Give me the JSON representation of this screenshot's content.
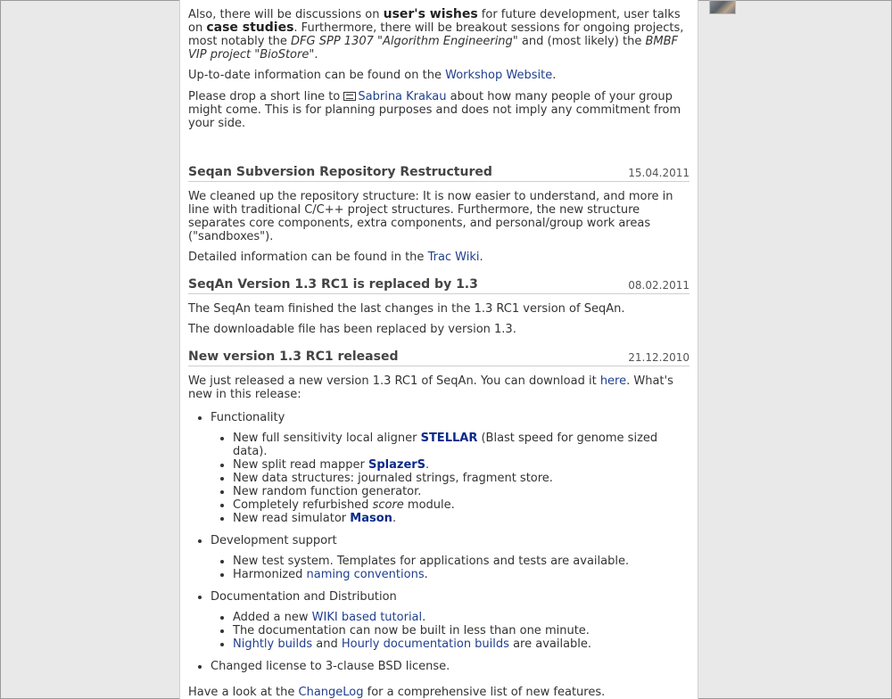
{
  "intro": {
    "p1": {
      "a": "Also, there will be discussions on ",
      "b": "user's wishes",
      "c": " for future development, user talks on ",
      "d": "case studies",
      "e": ". Furthermore, there will be breakout sessions for ongoing projects, most notably the ",
      "f": "DFG SPP 1307 \"Algorithm Engineering\"",
      "g": " and (most likely) the ",
      "h": "BMBF VIP project \"BioStore\"",
      "i": "."
    },
    "p2": {
      "a": "Up-to-date information can be found on the ",
      "link": "Workshop Website",
      "b": "."
    },
    "p3": {
      "a": "Please drop a short line to ",
      "link": "Sabrina Krakau",
      "b": " about how many people of your group might come. This is for planning purposes and does not imply any commitment from your side."
    }
  },
  "news": [
    {
      "title": "Seqan Subversion Repository Restructured",
      "date": "15.04.2011",
      "p1": "We cleaned up the repository structure: It is now easier to understand, and more in line with traditional C/C++ project structures. Furthermore, the new structure separates core components, extra components, and personal/group work areas (\"sandboxes\").",
      "p2a": "Detailed information can be found in the ",
      "p2link": "Trac Wiki",
      "p2b": "."
    },
    {
      "title": "SeqAn Version 1.3 RC1 is replaced by 1.3",
      "date": "08.02.2011",
      "p1": "The SeqAn team finished the last changes in the 1.3 RC1 version of SeqAn.",
      "p2": "The downloadable file has been replaced by version 1.3."
    },
    {
      "title": "New version 1.3 RC1 released",
      "date": "21.12.2010",
      "p1a": "We just released a new version 1.3 RC1 of SeqAn. You can download it ",
      "p1link": "here",
      "p1b": ". What's new in this release:"
    }
  ],
  "release": {
    "functionality": "Functionality",
    "f1a": "New full sensitivity local aligner ",
    "f1link": "STELLAR",
    "f1b": " (Blast speed for genome sized data).",
    "f2a": "New split read mapper ",
    "f2link": "SplazerS",
    "f2b": ".",
    "f3": "New data structures: journaled strings, fragment store.",
    "f4": "New random function generator.",
    "f5a": "Completely refurbished ",
    "f5em": "score",
    "f5b": " module.",
    "f6a": "New read simulator ",
    "f6link": "Mason",
    "f6b": ".",
    "devsupport": "Development support",
    "d1": "New test system. Templates for applications and tests are available.",
    "d2a": "Harmonized ",
    "d2link": "naming conventions",
    "d2b": ".",
    "docdist": "Documentation and Distribution",
    "o1a": "Added a new ",
    "o1link": "WIKI based tutorial",
    "o1b": ".",
    "o2": "The documentation can now be built in less than one minute.",
    "o3link1": "Nightly builds",
    "o3a": " and ",
    "o3link2": "Hourly documentation builds",
    "o3b": " are available.",
    "license": "Changed license to 3-clause BSD license.",
    "footer_a": "Have a look at the ",
    "footer_link": "ChangeLog",
    "footer_b": " for a comprehensive list of new features."
  }
}
